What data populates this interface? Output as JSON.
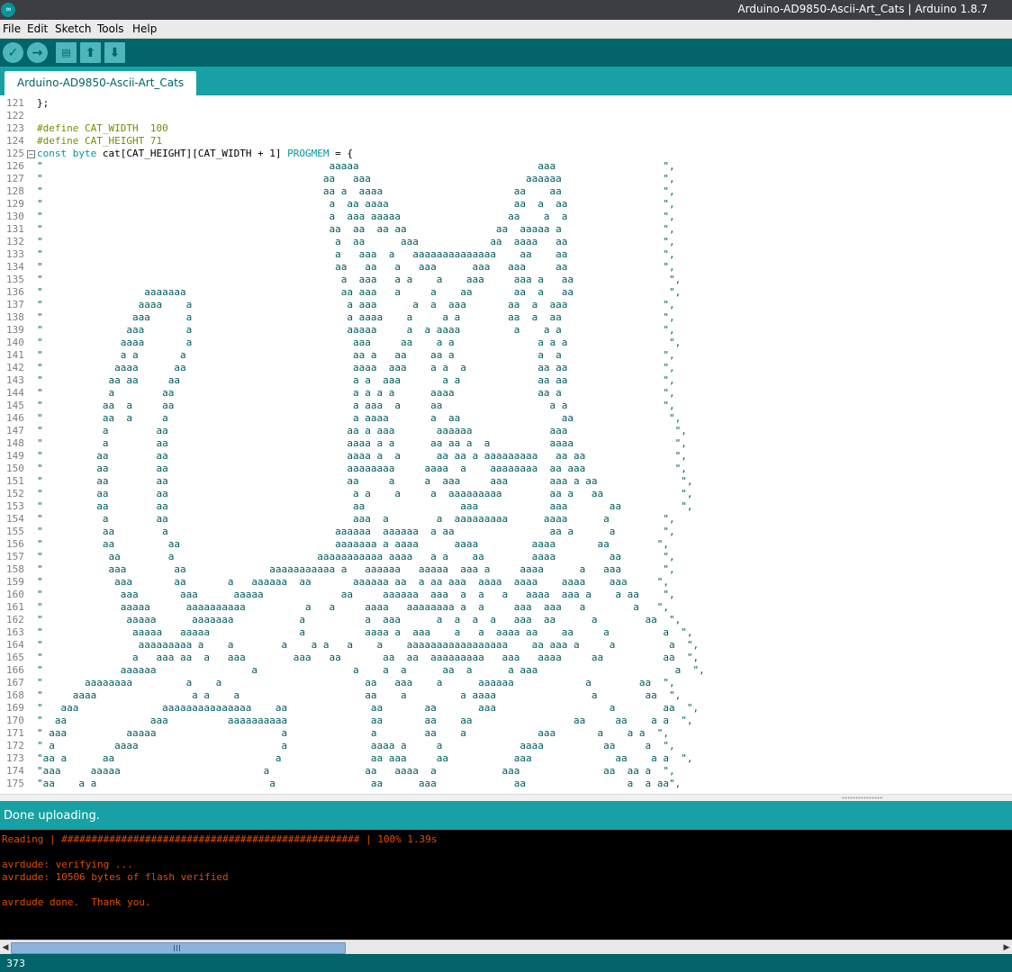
{
  "window": {
    "title": "Arduino-AD9850-Ascii-Art_Cats | Arduino 1.8.7",
    "app_icon": "arduino-logo"
  },
  "menu": {
    "items": [
      "File",
      "Edit",
      "Sketch",
      "Tools",
      "Help"
    ]
  },
  "toolbar": {
    "buttons": [
      "verify",
      "upload",
      "new",
      "open",
      "save"
    ]
  },
  "tab": {
    "label": "Arduino-AD9850-Ascii-Art_Cats"
  },
  "editor": {
    "lines": [
      {
        "n": "121",
        "t": "};"
      },
      {
        "n": "122",
        "t": ""
      },
      {
        "n": "123",
        "t": "#define CAT_WIDTH  100"
      },
      {
        "n": "124",
        "t": "#define CAT_HEIGHT 71"
      },
      {
        "n": "125",
        "t": "const byte cat[CAT_HEIGHT][CAT_WIDTH + 1] PROGMEM = {"
      },
      {
        "n": "126",
        "t": "\"                                                aaaaa                              aaa                  \","
      },
      {
        "n": "127",
        "t": "\"                                               aa   aaa                          aaaaaa                 \","
      },
      {
        "n": "128",
        "t": "\"                                               aa a  aaaa                      aa    aa                 \","
      },
      {
        "n": "129",
        "t": "\"                                                a  aa aaaa                     aa  a  aa                \","
      },
      {
        "n": "130",
        "t": "\"                                                a  aaa aaaaa                  aa    a  a                \","
      },
      {
        "n": "131",
        "t": "\"                                                aa  aa  aa aa               aa  aaaaa a                 \","
      },
      {
        "n": "132",
        "t": "\"                                                 a  aa      aaa            aa  aaaa   aa                \","
      },
      {
        "n": "133",
        "t": "\"                                                 a   aaa  a   aaaaaaaaaaaaaa    aa    aa                \","
      },
      {
        "n": "134",
        "t": "\"                                                 aa   aa   a   aaa      aaa   aaa     aa                \","
      },
      {
        "n": "135",
        "t": "\"                                                  a  aaa   a a    a    aaa     aaa a   aa                \","
      },
      {
        "n": "136",
        "t": "\"                 aaaaaaa                          aa aaa   a     a    aa       aa  a   aa                \","
      },
      {
        "n": "137",
        "t": "\"                aaaa    a                          a aaa      a  a  aaa       aa  a  aaa                \","
      },
      {
        "n": "138",
        "t": "\"               aaa      a                          a aaaa    a     a a        aa  a  aa                 \","
      },
      {
        "n": "139",
        "t": "\"              aaa       a                          aaaaa     a  a aaaa         a    a a                 \","
      },
      {
        "n": "140",
        "t": "\"             aaaa       a                           aaa     aa    a a              a a a                 \","
      },
      {
        "n": "141",
        "t": "\"             a a       a                            aa a   aa    aa a              a  a                 \","
      },
      {
        "n": "142",
        "t": "\"            aaaa      aa                            aaaa  aaa    a a  a            aa aa                \","
      },
      {
        "n": "143",
        "t": "\"           aa aa     aa                             a a  aaa       a a             aa aa                \","
      },
      {
        "n": "144",
        "t": "\"           a        aa                              a a a a      aaaa              aa a                 \","
      },
      {
        "n": "145",
        "t": "\"          aa  a     aa                              a aaa  a     aa                  a a                \","
      },
      {
        "n": "146",
        "t": "\"          aa  a     a                               a aaaa       a  aa                 aa                \","
      },
      {
        "n": "147",
        "t": "\"          a        aa                              aa a aaa       aaaaaa             aaa                  \","
      },
      {
        "n": "148",
        "t": "\"          a        aa                              aaaa a a      aa aa a  a          aaaa                 \","
      },
      {
        "n": "149",
        "t": "\"         aa        aa                              aaaa a  a      aa aa a aaaaaaaaa   aa aa               \","
      },
      {
        "n": "150",
        "t": "\"         aa        aa                              aaaaaaaa     aaaa  a    aaaaaaaa  aa aaa               \","
      },
      {
        "n": "151",
        "t": "\"         aa        aa                              aa     a     a  aaa     aaa       aaa a aa              \","
      },
      {
        "n": "152",
        "t": "\"         aa        aa                               a a    a     a  aaaaaaaaa        aa a   aa             \","
      },
      {
        "n": "153",
        "t": "\"         aa        aa                               aa                aaa            aaa       aa          \","
      },
      {
        "n": "154",
        "t": "\"          a        aa                               aaa  a        a  aaaaaaaaa      aaaa      a         \","
      },
      {
        "n": "155",
        "t": "\"          aa        a                            aaaaaa  aaaaaa  a aa                aa a      a        \","
      },
      {
        "n": "156",
        "t": "\"          aa         aa                          aaaaaaa a aaaa      aaaa         aaaa       aa        \","
      },
      {
        "n": "157",
        "t": "\"           aa        a                        aaaaaaaaaaa aaaa   a a    aa        aaaa         aa       \","
      },
      {
        "n": "158",
        "t": "\"           aaa        aa              aaaaaaaaaaa a   aaaaaa   aaaaa  aaa a     aaaa      a   aaa       \","
      },
      {
        "n": "159",
        "t": "\"            aaa       aa       a   aaaaaa  aa       aaaaaa aa  a aa aaa  aaaa  aaaa    aaaa    aaa     \","
      },
      {
        "n": "160",
        "t": "\"             aaa       aaa      aaaaa             aa     aaaaaa  aaa  a  a   a   aaaa  aaa a    a aa    \","
      },
      {
        "n": "161",
        "t": "\"             aaaaa      aaaaaaaaaa          a   a     aaaa   aaaaaaaa a  a     aaa  aaa   a        a   \","
      },
      {
        "n": "162",
        "t": "\"              aaaaa      aaaaaaa           a          a  aaa      a  a  a  a   aaa  aa      a        aa  \","
      },
      {
        "n": "163",
        "t": "\"               aaaaa   aaaaa               a          aaaa a  aaa    a   a  aaaa aa    aa     a         a  \","
      },
      {
        "n": "164",
        "t": "\"                aaaaaaaaa a    a        a    a a   a    a    aaaaaaaaaaaaaaaaa    aa aaa a     a         a  \","
      },
      {
        "n": "165",
        "t": "\"               a   aaa aa  a   aaa        aaa   aa       aa  aa  aaaaaaaaa   aaa   aaaa     aa          aa  \","
      },
      {
        "n": "166",
        "t": "\"             aaaaaa                a                a    a  a      aa  a      a aaa                       a  \","
      },
      {
        "n": "167",
        "t": "\"       aaaaaaaa         a    a                        aa   aaa    a      aaaaaa            a        aa  \","
      },
      {
        "n": "168",
        "t": "\"     aaaa                a a    a                     aa    a         a aaaa                a        aa  \","
      },
      {
        "n": "169",
        "t": "\"   aaa              aaaaaaaaaaaaaaa    aa              aa       aa       aaa                   a        aa  \","
      },
      {
        "n": "170",
        "t": "\"  aa              aaa          aaaaaaaaaa              aa       aa    aa                 aa     aa    a a  \","
      },
      {
        "n": "171",
        "t": "\" aaa          aaaaa                     a              a        aa    a            aaa       a    a a  \","
      },
      {
        "n": "172",
        "t": "\" a          aaaa                        a              aaaa a     a             aaaa          aa     a  \","
      },
      {
        "n": "173",
        "t": "\"aa a      aa                           a               aa aaa     aa           aaa              aa    a a  \","
      },
      {
        "n": "174",
        "t": "\"aaa     aaaaa                        a                aa   aaaa  a           aaa              aa  aa a  \","
      },
      {
        "n": "175",
        "t": "\"aa    a a                             a                aa      aaa             aa                 a  a aa\","
      }
    ]
  },
  "status": {
    "message": "Done uploading."
  },
  "console": {
    "lines": [
      "Reading | ################################################## | 100% 1.39s",
      "",
      "avrdude: verifying ...",
      "avrdude: 10506 bytes of flash verified",
      "",
      "avrdude done.  Thank you."
    ]
  },
  "footer": {
    "line_number": "373"
  },
  "colors": {
    "titlebar": "#3b3f44",
    "toolbar": "#006468",
    "accent": "#17a1a5",
    "console_text": "#e34c00",
    "keyword": "#00979c",
    "preprocessor": "#728e00"
  }
}
